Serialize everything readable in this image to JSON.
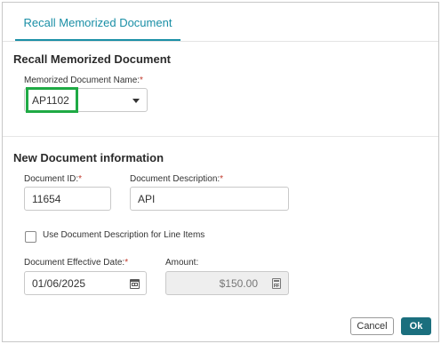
{
  "tab": {
    "label": "Recall Memorized Document"
  },
  "recall_section": {
    "title": "Recall Memorized Document",
    "name_label": "Memorized Document Name:",
    "required_mark": "*",
    "name_value": "AP1102"
  },
  "new_section": {
    "title": "New Document information",
    "document_id_label": "Document ID:",
    "document_id_value": "11654",
    "description_label": "Document Description:",
    "description_value": "API",
    "checkbox_label": "Use Document Description for Line Items",
    "checkbox_checked": false,
    "effective_date_label": "Document Effective Date:",
    "effective_date_value": "01/06/2025",
    "amount_label": "Amount:",
    "amount_value": "$150.00"
  },
  "buttons": {
    "cancel": "Cancel",
    "ok": "Ok"
  },
  "colors": {
    "accent": "#1a8fa6",
    "primary_button": "#1b6f7e",
    "focus_highlight": "#1faa45",
    "required": "#c0392b"
  },
  "icons": {
    "dropdown": "chevron-down-icon",
    "date": "calendar-icon",
    "amount": "calculator-icon"
  }
}
